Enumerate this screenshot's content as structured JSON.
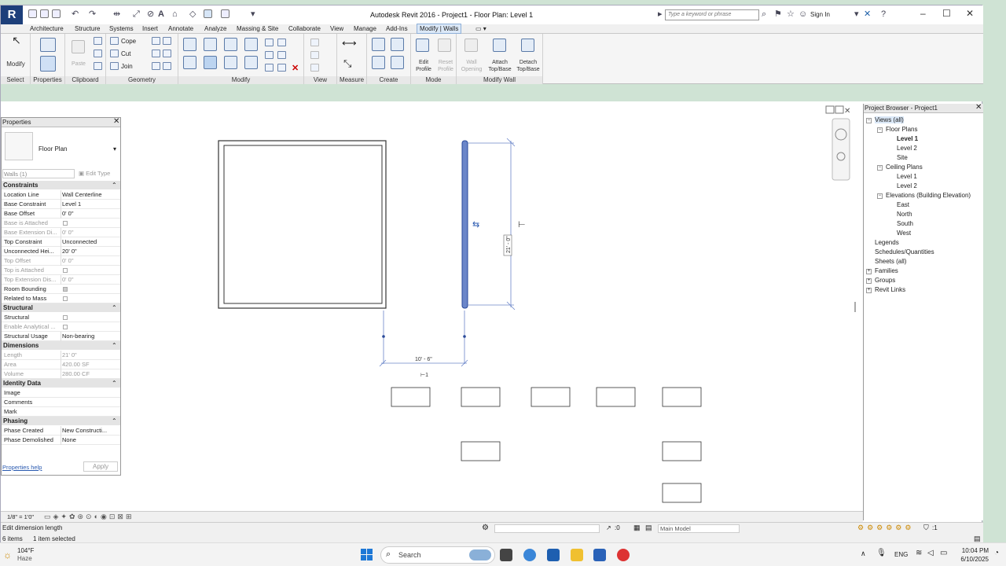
{
  "window": {
    "title": "Autodesk Revit 2016 -    Project1 - Floor Plan: Level 1",
    "search_placeholder": "Type a keyword or phrase",
    "sign_in": "Sign In",
    "logo": "R"
  },
  "tabs": [
    "Architecture",
    "Structure",
    "Systems",
    "Insert",
    "Annotate",
    "Analyze",
    "Massing & Site",
    "Collaborate",
    "View",
    "Manage",
    "Add-Ins",
    "Modify | Walls"
  ],
  "ribbon": {
    "select": {
      "label": "Select",
      "button": "Modify"
    },
    "properties": {
      "label": "Properties"
    },
    "clipboard": {
      "label": "Clipboard",
      "paste": "Paste"
    },
    "geometry": {
      "label": "Geometry",
      "cope": "Cope",
      "cut": "Cut",
      "join": "Join"
    },
    "modify": {
      "label": "Modify"
    },
    "view": {
      "label": "View"
    },
    "measure": {
      "label": "Measure"
    },
    "create": {
      "label": "Create"
    },
    "mode": {
      "label": "Mode",
      "edit_profile": "Edit Profile",
      "reset_profile": "Reset Profile"
    },
    "modify_wall": {
      "label": "Modify Wall",
      "wall_opening": "Wall Opening",
      "attach": "Attach Top/Base",
      "detach": "Detach Top/Base"
    }
  },
  "properties": {
    "title": "Properties",
    "type_name": "Floor Plan",
    "filter": "Walls (1)",
    "edit_type": "Edit Type",
    "help": "Properties help",
    "apply": "Apply",
    "sections": [
      {
        "name": "Constraints",
        "rows": [
          {
            "k": "Location Line",
            "v": "Wall Centerline"
          },
          {
            "k": "Base Constraint",
            "v": "Level 1"
          },
          {
            "k": "Base Offset",
            "v": "0' 0\""
          },
          {
            "k": "Base is Attached",
            "v": ""
          },
          {
            "k": "Base Extension Di...",
            "v": "0' 0\""
          },
          {
            "k": "Top Constraint",
            "v": "Unconnected"
          },
          {
            "k": "Unconnected Hei...",
            "v": "20' 0\""
          },
          {
            "k": "Top Offset",
            "v": "0' 0\""
          },
          {
            "k": "Top is Attached",
            "v": ""
          },
          {
            "k": "Top Extension Dis...",
            "v": "0' 0\""
          },
          {
            "k": "Room Bounding",
            "v": ""
          },
          {
            "k": "Related to Mass",
            "v": ""
          }
        ]
      },
      {
        "name": "Structural",
        "rows": [
          {
            "k": "Structural",
            "v": ""
          },
          {
            "k": "Enable Analytical ...",
            "v": ""
          },
          {
            "k": "Structural Usage",
            "v": "Non-bearing"
          }
        ]
      },
      {
        "name": "Dimensions",
        "rows": [
          {
            "k": "Length",
            "v": "21' 0\""
          },
          {
            "k": "Area",
            "v": "420.00 SF"
          },
          {
            "k": "Volume",
            "v": "280.00 CF"
          }
        ]
      },
      {
        "name": "Identity Data",
        "rows": [
          {
            "k": "Image",
            "v": ""
          },
          {
            "k": "Comments",
            "v": ""
          },
          {
            "k": "Mark",
            "v": ""
          }
        ]
      },
      {
        "name": "Phasing",
        "rows": [
          {
            "k": "Phase Created",
            "v": "New Constructi..."
          },
          {
            "k": "Phase Demolished",
            "v": "None"
          }
        ]
      }
    ]
  },
  "canvas": {
    "dim_horizontal": "10' - 6\"",
    "dim_vertical": "21' - 0\""
  },
  "browser": {
    "title": "Project Browser - Project1",
    "items": [
      {
        "t": "Views (all)"
      },
      {
        "t": "Floor Plans"
      },
      {
        "t": "Level 1"
      },
      {
        "t": "Level 2"
      },
      {
        "t": "Site"
      },
      {
        "t": "Ceiling Plans"
      },
      {
        "t": "Level 1"
      },
      {
        "t": "Level 2"
      },
      {
        "t": "Elevations (Building Elevation)"
      },
      {
        "t": "East"
      },
      {
        "t": "North"
      },
      {
        "t": "South"
      },
      {
        "t": "West"
      },
      {
        "t": "Legends"
      },
      {
        "t": "Schedules/Quantities"
      },
      {
        "t": "Sheets (all)"
      },
      {
        "t": "Families"
      },
      {
        "t": "Groups"
      },
      {
        "t": "Revit Links"
      }
    ]
  },
  "viewbar": {
    "scale": "1/8\" = 1'0\""
  },
  "status": {
    "message": "Edit dimension length",
    "items": "6 items",
    "selected": "1 item selected",
    "coord": ":0",
    "model": "Main Model",
    "sel_count": ":1"
  },
  "taskbar": {
    "weather_temp": "104°F",
    "weather_desc": "Haze",
    "search": "Search",
    "lang": "ENG",
    "time": "10:04 PM",
    "date": "6/10/2025"
  }
}
